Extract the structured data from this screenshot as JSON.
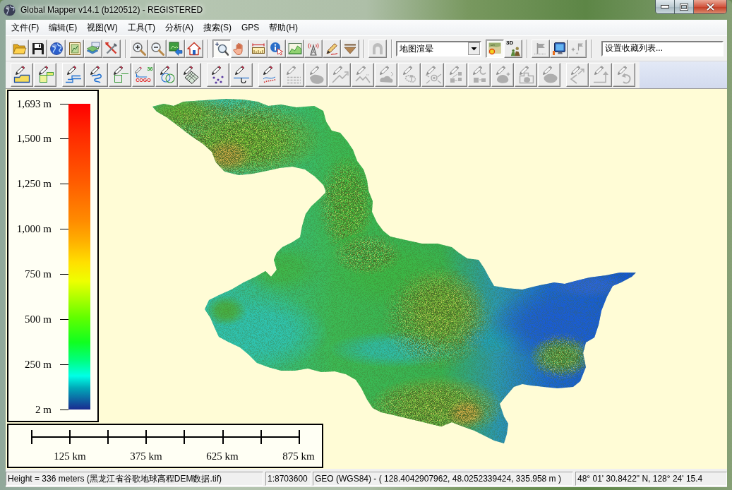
{
  "window": {
    "title": "Global Mapper v14.1 (b120512) - REGISTERED"
  },
  "menu": [
    {
      "label": "文件(F)"
    },
    {
      "label": "编辑(E)"
    },
    {
      "label": "视图(W)"
    },
    {
      "label": "工具(T)"
    },
    {
      "label": "分析(A)"
    },
    {
      "label": "搜索(S)"
    },
    {
      "label": "GPS"
    },
    {
      "label": "帮助(H)"
    }
  ],
  "toolbars": [
    {
      "groups": [
        {
          "items": [
            {
              "kind": "button",
              "disabled": false,
              "pressed": false
            },
            {
              "kind": "button",
              "disabled": false,
              "pressed": false
            },
            {
              "kind": "button",
              "disabled": false,
              "pressed": false
            },
            {
              "kind": "button",
              "disabled": false,
              "pressed": false
            },
            {
              "kind": "button",
              "disabled": false,
              "pressed": false
            },
            {
              "kind": "button",
              "disabled": false,
              "pressed": false
            }
          ]
        },
        {
          "items": [
            {
              "kind": "button",
              "disabled": false,
              "pressed": false
            },
            {
              "kind": "button",
              "disabled": false,
              "pressed": false
            },
            {
              "kind": "button",
              "disabled": false,
              "pressed": false
            },
            {
              "kind": "button",
              "disabled": false,
              "pressed": false
            }
          ]
        },
        {
          "items": [
            {
              "kind": "button",
              "disabled": false,
              "pressed": true
            },
            {
              "kind": "button",
              "disabled": false,
              "pressed": false
            },
            {
              "kind": "button",
              "disabled": false,
              "pressed": false
            },
            {
              "kind": "button",
              "disabled": false,
              "pressed": false
            },
            {
              "kind": "button",
              "disabled": false,
              "pressed": false
            },
            {
              "kind": "button",
              "disabled": false,
              "pressed": false
            },
            {
              "kind": "button",
              "disabled": false,
              "pressed": false
            },
            {
              "kind": "button",
              "disabled": false,
              "pressed": false
            }
          ]
        },
        {
          "items": [
            {
              "kind": "button",
              "disabled": true,
              "pressed": false
            }
          ]
        },
        {
          "items": [
            {
              "kind": "dropdown",
              "value": "地图渲晕"
            },
            {
              "kind": "button",
              "disabled": false,
              "pressed": true
            },
            {
              "kind": "button",
              "text": [
                "3D"
              ],
              "disabled": false,
              "pressed": false
            }
          ]
        },
        {
          "items": [
            {
              "kind": "button",
              "disabled": true,
              "pressed": false
            },
            {
              "kind": "button",
              "disabled": false,
              "pressed": false
            },
            {
              "kind": "button",
              "disabled": true,
              "pressed": false
            }
          ]
        },
        {
          "items": [
            {
              "kind": "field",
              "value": "设置收藏列表..."
            }
          ]
        }
      ]
    },
    {
      "groups": [
        {
          "items": [
            {
              "kind": "button",
              "disabled": false,
              "pressed": false
            },
            {
              "kind": "button",
              "disabled": false,
              "pressed": false
            }
          ]
        },
        {
          "items": [
            {
              "kind": "button",
              "disabled": false,
              "pressed": false
            },
            {
              "kind": "button",
              "disabled": false,
              "pressed": false
            },
            {
              "kind": "button",
              "disabled": false,
              "pressed": false
            },
            {
              "kind": "button",
              "text": [
                "36",
                "COGO"
              ],
              "disabled": false,
              "pressed": false
            },
            {
              "kind": "button",
              "disabled": false,
              "pressed": false
            },
            {
              "kind": "button",
              "disabled": false,
              "pressed": false
            }
          ]
        },
        {
          "items": [
            {
              "kind": "button",
              "disabled": false,
              "pressed": false
            },
            {
              "kind": "button",
              "disabled": false,
              "pressed": false
            }
          ]
        },
        {
          "items": [
            {
              "kind": "button",
              "disabled": false,
              "pressed": false
            },
            {
              "kind": "button",
              "disabled": true,
              "pressed": false
            },
            {
              "kind": "button",
              "disabled": true,
              "pressed": false
            },
            {
              "kind": "button",
              "disabled": true,
              "pressed": false
            },
            {
              "kind": "button",
              "disabled": true,
              "pressed": false
            },
            {
              "kind": "button",
              "disabled": true,
              "pressed": false
            },
            {
              "kind": "button",
              "disabled": true,
              "pressed": false
            },
            {
              "kind": "button",
              "disabled": true,
              "pressed": false
            },
            {
              "kind": "button",
              "disabled": true,
              "pressed": false
            },
            {
              "kind": "button",
              "disabled": true,
              "pressed": false
            },
            {
              "kind": "button",
              "disabled": true,
              "pressed": false
            },
            {
              "kind": "button",
              "disabled": true,
              "pressed": false
            },
            {
              "kind": "button",
              "disabled": true,
              "pressed": false
            }
          ]
        },
        {
          "items": [
            {
              "kind": "button",
              "disabled": true,
              "pressed": false
            },
            {
              "kind": "button",
              "disabled": true,
              "pressed": false
            },
            {
              "kind": "button",
              "disabled": true,
              "pressed": false
            }
          ]
        }
      ]
    }
  ],
  "legend": {
    "labels": [
      "1,693 m",
      "1,500 m",
      "1,250 m",
      "1,000 m",
      "750 m",
      "500 m",
      "250 m",
      "2 m"
    ]
  },
  "scale_bar": {
    "labels": [
      "125 km",
      "375 km",
      "625 km",
      "875 km"
    ]
  },
  "status_bar": [
    {
      "text": "Height = 336 meters (黑龙江省谷歌地球高程DEM数据.tif)"
    },
    {
      "text": "1:8703600"
    },
    {
      "text": "GEO (WGS84) - ( 128.4042907962, 48.0252339424, 335.958 m )"
    },
    {
      "text": "48° 01' 30.8422\" N, 128° 24' 15.4"
    }
  ]
}
